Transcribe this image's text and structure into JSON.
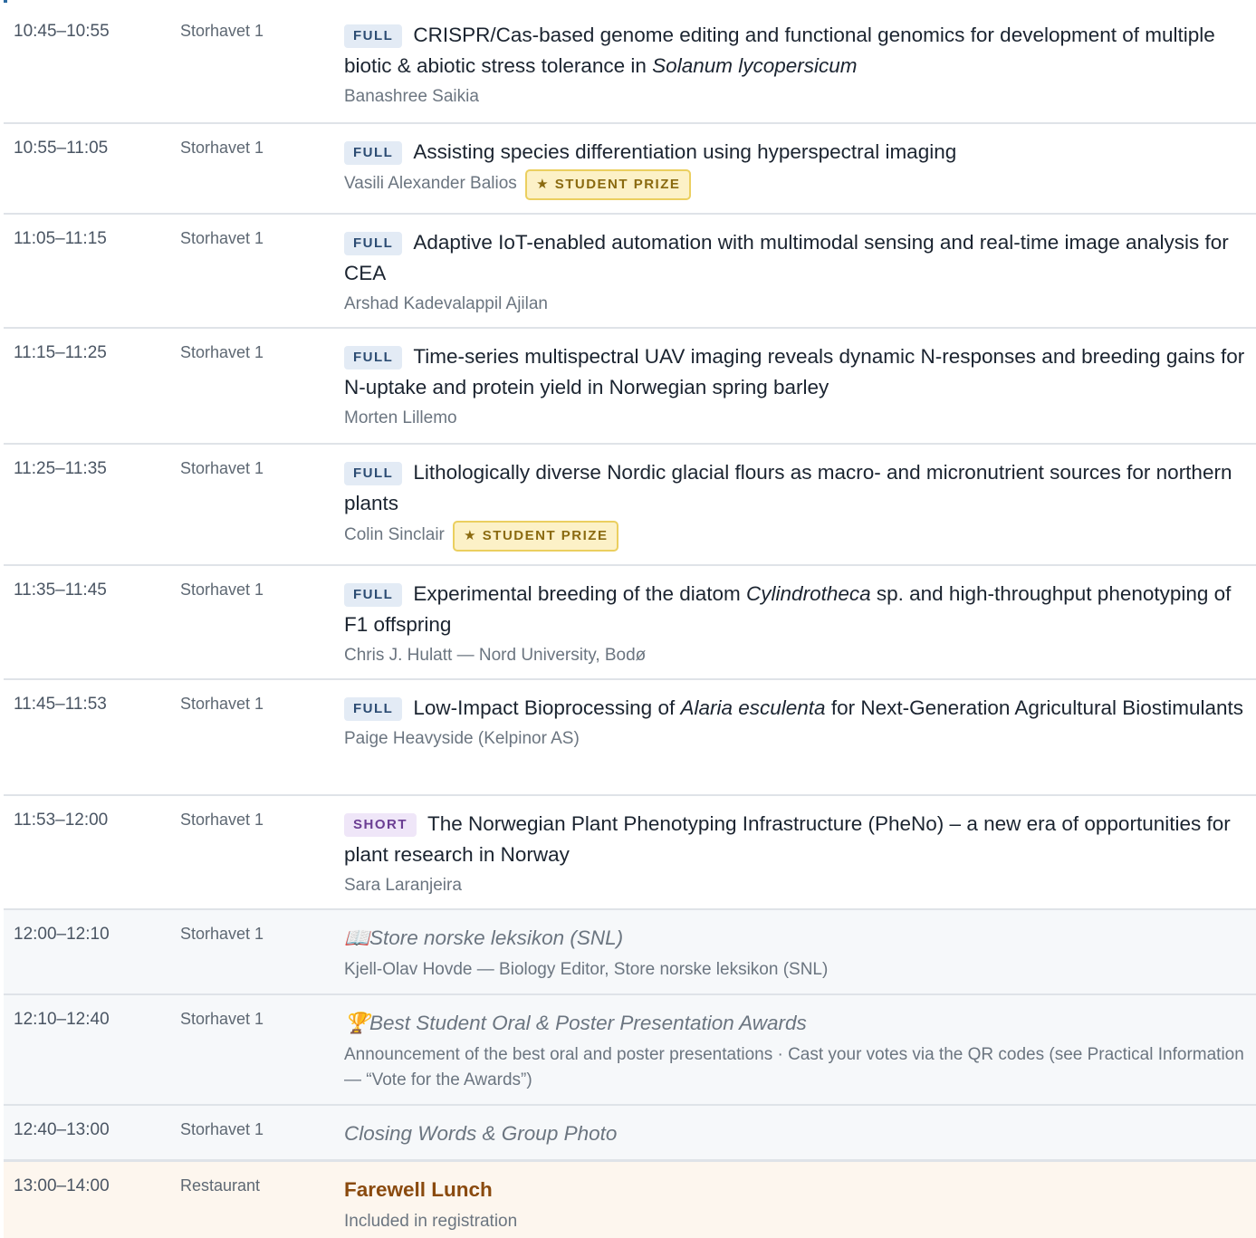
{
  "rows": [
    {
      "time": "10:45–10:55",
      "room": "Storhavet 1",
      "badge": "FULL",
      "title_a": "CRISPR/Cas-based genome editing and functional genomics for development of multiple biotic & abiotic stress tolerance in ",
      "title_b": "Solanum lycopersicum",
      "title_c": "",
      "author": "Banashree Saikia"
    },
    {
      "time": "10:55–11:05",
      "room": "Storhavet 1",
      "badge": "FULL",
      "title": "Assisting species differentiation using hyperspectral imaging",
      "author": "Vasili Alexander Balios",
      "prize": "★ STUDENT PRIZE"
    },
    {
      "time": "11:05–11:15",
      "room": "Storhavet 1",
      "badge": "FULL",
      "title": "Adaptive IoT-enabled automation with multimodal sensing and real-time image analysis for CEA",
      "author": "Arshad Kadevalappil Ajilan"
    },
    {
      "time": "11:15–11:25",
      "room": "Storhavet 1",
      "badge": "FULL",
      "title": "Time-series multispectral UAV imaging reveals dynamic N-responses and breeding gains for N-uptake and protein yield in Norwegian spring barley",
      "author": "Morten Lillemo"
    },
    {
      "time": "11:25–11:35",
      "room": "Storhavet 1",
      "badge": "FULL",
      "title": "Lithologically diverse Nordic glacial flours as macro- and micronutrient sources for northern plants",
      "author": "Colin Sinclair",
      "prize": "★ STUDENT PRIZE"
    },
    {
      "time": "11:35–11:45",
      "room": "Storhavet 1",
      "badge": "FULL",
      "title_a": "Experimental breeding of the diatom ",
      "title_b": "Cylindrotheca",
      "title_c": " sp. and high-throughput phenotyping of F1 offspring",
      "author": "Chris J. Hulatt — Nord University, Bodø"
    },
    {
      "time": "11:45–11:53",
      "room": "Storhavet 1",
      "badge": "FULL",
      "title_a": "Low-Impact Bioprocessing of ",
      "title_b": "Alaria esculenta",
      "title_c": " for Next-Generation Agricultural Biostimulants",
      "author": "Paige Heavyside (Kelpinor AS)"
    },
    {
      "time": "11:53–12:00",
      "room": "Storhavet 1",
      "badge": "SHORT",
      "title": "The Norwegian Plant Phenotyping Infrastructure (PheNo) – a new era of opportunities for plant research in Norway",
      "author": "Sara Laranjeira"
    },
    {
      "time": "12:00–12:10",
      "room": "Storhavet 1",
      "icon": "📖",
      "title": "Store norske leksikon (SNL)",
      "desc": "Kjell-Olav Hovde — Biology Editor, Store norske leksikon (SNL)"
    },
    {
      "time": "12:10–12:40",
      "room": "Storhavet 1",
      "icon": "🏆",
      "title": "Best Student Oral & Poster Presentation Awards",
      "desc": "Announcement of the best oral and poster presentations · Cast your votes via the QR codes (see Practical Information — “Vote for the Awards”)"
    },
    {
      "time": "12:40–13:00",
      "room": "Storhavet 1",
      "title": "Closing Words & Group Photo"
    },
    {
      "time": "13:00–14:00",
      "room": "Restaurant",
      "title": "Farewell Lunch",
      "desc": "Included in registration"
    }
  ]
}
